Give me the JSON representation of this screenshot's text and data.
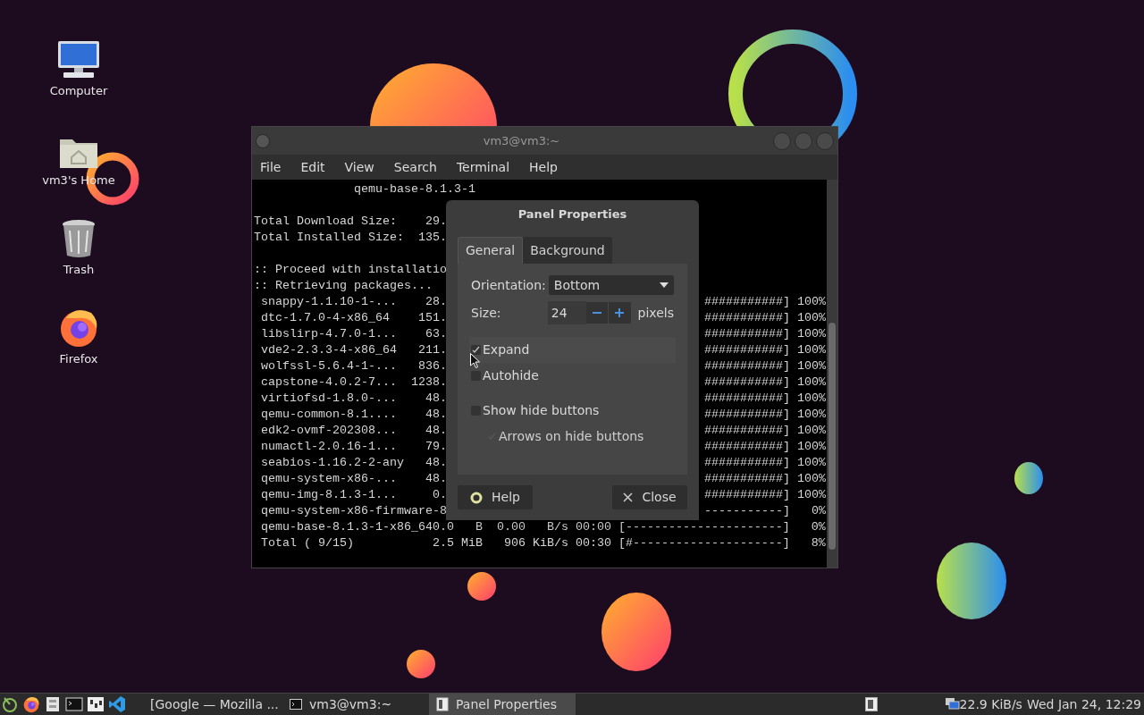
{
  "desktop": {
    "icons": [
      {
        "label": "Computer",
        "kind": "computer"
      },
      {
        "label": "vm3's Home",
        "kind": "home"
      },
      {
        "label": "Trash",
        "kind": "trash"
      },
      {
        "label": "Firefox",
        "kind": "firefox"
      }
    ]
  },
  "terminal": {
    "title": "vm3@vm3:~",
    "menu": [
      "File",
      "Edit",
      "View",
      "Search",
      "Terminal",
      "Help"
    ],
    "lines": [
      {
        "left": "              qemu-base-8.1.3-1"
      },
      {
        "left": "Total Download Size:    29.",
        "gap_before": true
      },
      {
        "left": "Total Installed Size:  135."
      },
      {
        "left": ":: Proceed with installatio",
        "gap_before": true
      },
      {
        "left": ":: Retrieving packages..."
      },
      {
        "left": " snappy-1.1.10-1-...    28.",
        "right": "###########] 100%"
      },
      {
        "left": " dtc-1.7.0-4-x86_64    151.",
        "right": "###########] 100%"
      },
      {
        "left": " libslirp-4.7.0-1...    63.",
        "right": "###########] 100%"
      },
      {
        "left": " vde2-2.3.3-4-x86_64   211.",
        "right": "###########] 100%"
      },
      {
        "left": " wolfssl-5.6.4-1-...   836.",
        "right": "###########] 100%"
      },
      {
        "left": " capstone-4.0.2-7...  1238.",
        "right": "###########] 100%"
      },
      {
        "left": " virtiofsd-1.8.0-...    48.",
        "right": "###########] 100%"
      },
      {
        "left": " qemu-common-8.1....    48.",
        "right": "###########] 100%"
      },
      {
        "left": " edk2-ovmf-202308...    48.",
        "right": "###########] 100%"
      },
      {
        "left": " numactl-2.0.16-1...    79.",
        "right": "###########] 100%"
      },
      {
        "left": " seabios-1.16.2-2-any   48.",
        "right": "###########] 100%"
      },
      {
        "left": " qemu-system-x86-...    48.",
        "right": "###########] 100%"
      },
      {
        "left": " qemu-img-8.1.3-1...     0.",
        "right": "###########] 100%"
      },
      {
        "left": " qemu-system-x86-firmware-8",
        "right": "-----------]   0%"
      },
      {
        "left": " qemu-base-8.1.3-1-x86_640.0   B  0.00   B/s 00:00 [----------------------]   0%"
      },
      {
        "left": " Total ( 9/15)           2.5 MiB   906 KiB/s 00:30 [#---------------------]   8%"
      }
    ]
  },
  "dialog": {
    "title": "Panel Properties",
    "tabs": [
      {
        "label": "General",
        "selected": true
      },
      {
        "label": "Background",
        "selected": false
      }
    ],
    "orientation": {
      "label": "Orientation:",
      "value": "Bottom"
    },
    "size": {
      "label": "Size:",
      "value": "24",
      "unit": "pixels"
    },
    "options": [
      {
        "label": "Expand",
        "checked": true,
        "disabled": false,
        "hovered": true,
        "indented": false
      },
      {
        "label": "Autohide",
        "checked": false,
        "disabled": false,
        "hovered": false,
        "indented": false
      },
      {
        "label": "Show hide buttons",
        "checked": false,
        "disabled": false,
        "hovered": false,
        "indented": false
      },
      {
        "label": "Arrows on hide buttons",
        "checked": true,
        "disabled": true,
        "hovered": false,
        "indented": true
      }
    ],
    "buttons": [
      {
        "label": "Help",
        "kind": "help"
      },
      {
        "label": "Close",
        "kind": "close"
      }
    ]
  },
  "taskbar": {
    "launchers": [
      {
        "kind": "menu"
      },
      {
        "kind": "firefox"
      },
      {
        "kind": "files"
      },
      {
        "kind": "terminal"
      },
      {
        "kind": "settings"
      },
      {
        "kind": "code"
      }
    ],
    "tasks": [
      {
        "label": "[Google — Mozilla ...",
        "kind": "firefox",
        "selected": false
      },
      {
        "label": "vm3@vm3:~",
        "kind": "terminal",
        "selected": false
      },
      {
        "label": "Panel Properties",
        "kind": "window",
        "selected": true
      }
    ],
    "network": "22.9 KiB/s",
    "clock": "Wed Jan 24, 12:29"
  }
}
